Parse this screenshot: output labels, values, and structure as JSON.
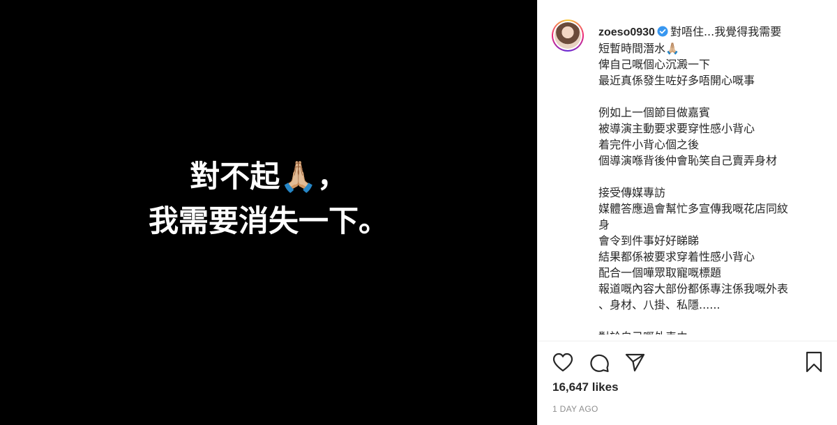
{
  "media": {
    "lines": [
      "對不起🙏🏼，",
      "我需要消失一下。"
    ]
  },
  "post": {
    "username": "zoeso0930",
    "caption_first": "對唔住...我覺得我需要",
    "caption_lines": [
      "短暫時間潛水🙏🏼",
      "俾自己嘅個心沉澱一下",
      "最近真係發生咗好多唔開心嘅事",
      "",
      "例如上一個節目做嘉賓",
      "被導演主動要求要穿性感小背心",
      "着完件小背心個之後",
      "個導演喺背後仲會恥笑自己賣弄身材",
      "",
      "接受傳媒專訪",
      "媒體答應過會幫忙多宣傳我嘅花店同紋",
      "身",
      "會令到件事好好睇睇",
      "結果都係被要求穿着性感小背心",
      "配合一個嘩眾取寵嘅標題",
      "報道嘅內容大部份都係專注係我嘅外表",
      "、身材、八掛、私隱......",
      "",
      "對於自己嘅外表由"
    ],
    "likes": "16,647 likes",
    "timestamp": "1 DAY AGO"
  },
  "icons": {
    "like": "heart-icon",
    "comment": "comment-icon",
    "share": "paper-plane-icon",
    "save": "bookmark-icon",
    "verified": "verified-badge-icon"
  },
  "colors": {
    "verified": "#3897f0",
    "text": "#262626",
    "muted": "#8e8e8e",
    "media_bg": "#000000"
  }
}
